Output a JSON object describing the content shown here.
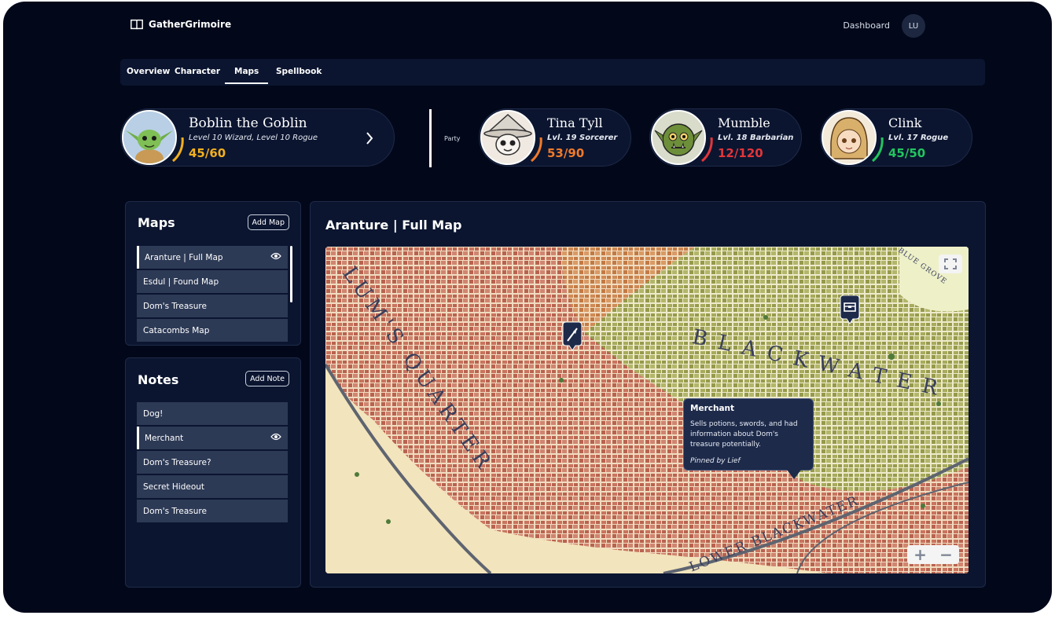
{
  "app": {
    "name": "GatherGrimoire"
  },
  "header": {
    "dashboard_label": "Dashboard",
    "user_initials": "LU"
  },
  "tabs": [
    {
      "label": "Overview"
    },
    {
      "label": "Character"
    },
    {
      "label": "Maps",
      "active": true
    },
    {
      "label": "Spellbook"
    }
  ],
  "character": {
    "name": "Boblin the Goblin",
    "class": "Level 10 Wizard, Level 10 Rogue",
    "hp": "45/60",
    "hp_fraction": 0.75,
    "hp_color": "#f2b01e"
  },
  "party": {
    "label": "Party",
    "members": [
      {
        "name": "Tina Tyll",
        "class": "Lvl. 19 Sorcerer",
        "hp": "53/90",
        "hp_fraction": 0.59,
        "hp_color": "#f07a2a"
      },
      {
        "name": "Mumble",
        "class": "Lvl. 18 Barbarian",
        "hp": "12/120",
        "hp_fraction": 0.1,
        "hp_color": "#e2363a"
      },
      {
        "name": "Clink",
        "class": "Lvl. 17 Rogue",
        "hp": "45/50",
        "hp_fraction": 0.9,
        "hp_color": "#22c55e"
      }
    ]
  },
  "maps_panel": {
    "title": "Maps",
    "add_label": "Add Map",
    "items": [
      {
        "label": "Aranture | Full Map",
        "active": true
      },
      {
        "label": "Esdul | Found Map"
      },
      {
        "label": "Dom's Treasure"
      },
      {
        "label": "Catacombs Map"
      }
    ]
  },
  "notes_panel": {
    "title": "Notes",
    "add_label": "Add Note",
    "items": [
      {
        "label": "Dog!"
      },
      {
        "label": "Merchant",
        "active": true
      },
      {
        "label": "Dom's Treasure?"
      },
      {
        "label": "Secret Hideout"
      },
      {
        "label": "Dom's Treasure"
      }
    ]
  },
  "map_view": {
    "title": "Aranture | Full Map",
    "region_labels": [
      "LUM'S QUARTER",
      "BLACKWATER",
      "LOWER BLACKWATER",
      "BLUE GROVE"
    ],
    "tooltip": {
      "title": "Merchant",
      "body": "Sells potions, swords, and had information about Dom's treasure potentially.",
      "pinned_by": "Pinned by Lief"
    },
    "zoom_in": "+",
    "zoom_out": "−"
  },
  "colors": {
    "background": "#02081a",
    "panel": "#0b1530",
    "list_item": "#2d3a56",
    "tooltip": "#1d2a4a"
  }
}
